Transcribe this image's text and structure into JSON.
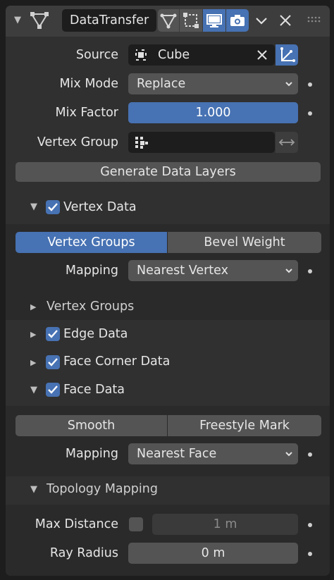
{
  "header": {
    "modifier_name": "DataTransfer"
  },
  "source": {
    "label": "Source",
    "value": "Cube"
  },
  "mix_mode": {
    "label": "Mix Mode",
    "value": "Replace"
  },
  "mix_factor": {
    "label": "Mix Factor",
    "value": "1.000",
    "fill_fraction": 1.0
  },
  "vertex_group": {
    "label": "Vertex Group",
    "value": ""
  },
  "generate_button": "Generate Data Layers",
  "vertex_data": {
    "label": "Vertex Data",
    "checked": true,
    "tabs": [
      "Vertex Groups",
      "Bevel Weight"
    ],
    "active_tab": "Vertex Groups",
    "mapping_label": "Mapping",
    "mapping_value": "Nearest Vertex",
    "sub_panel": "Vertex Groups"
  },
  "edge_data": {
    "label": "Edge Data",
    "checked": true
  },
  "face_corner_data": {
    "label": "Face Corner Data",
    "checked": true
  },
  "face_data": {
    "label": "Face Data",
    "checked": true,
    "tabs": [
      "Smooth",
      "Freestyle Mark"
    ],
    "mapping_label": "Mapping",
    "mapping_value": "Nearest Face"
  },
  "topology": {
    "label": "Topology Mapping",
    "max_distance_label": "Max Distance",
    "max_distance_value": "1 m",
    "ray_radius_label": "Ray Radius",
    "ray_radius_value": "0 m"
  },
  "colors": {
    "accent": "#4772b3",
    "panel": "#303030",
    "field": "#545454"
  }
}
